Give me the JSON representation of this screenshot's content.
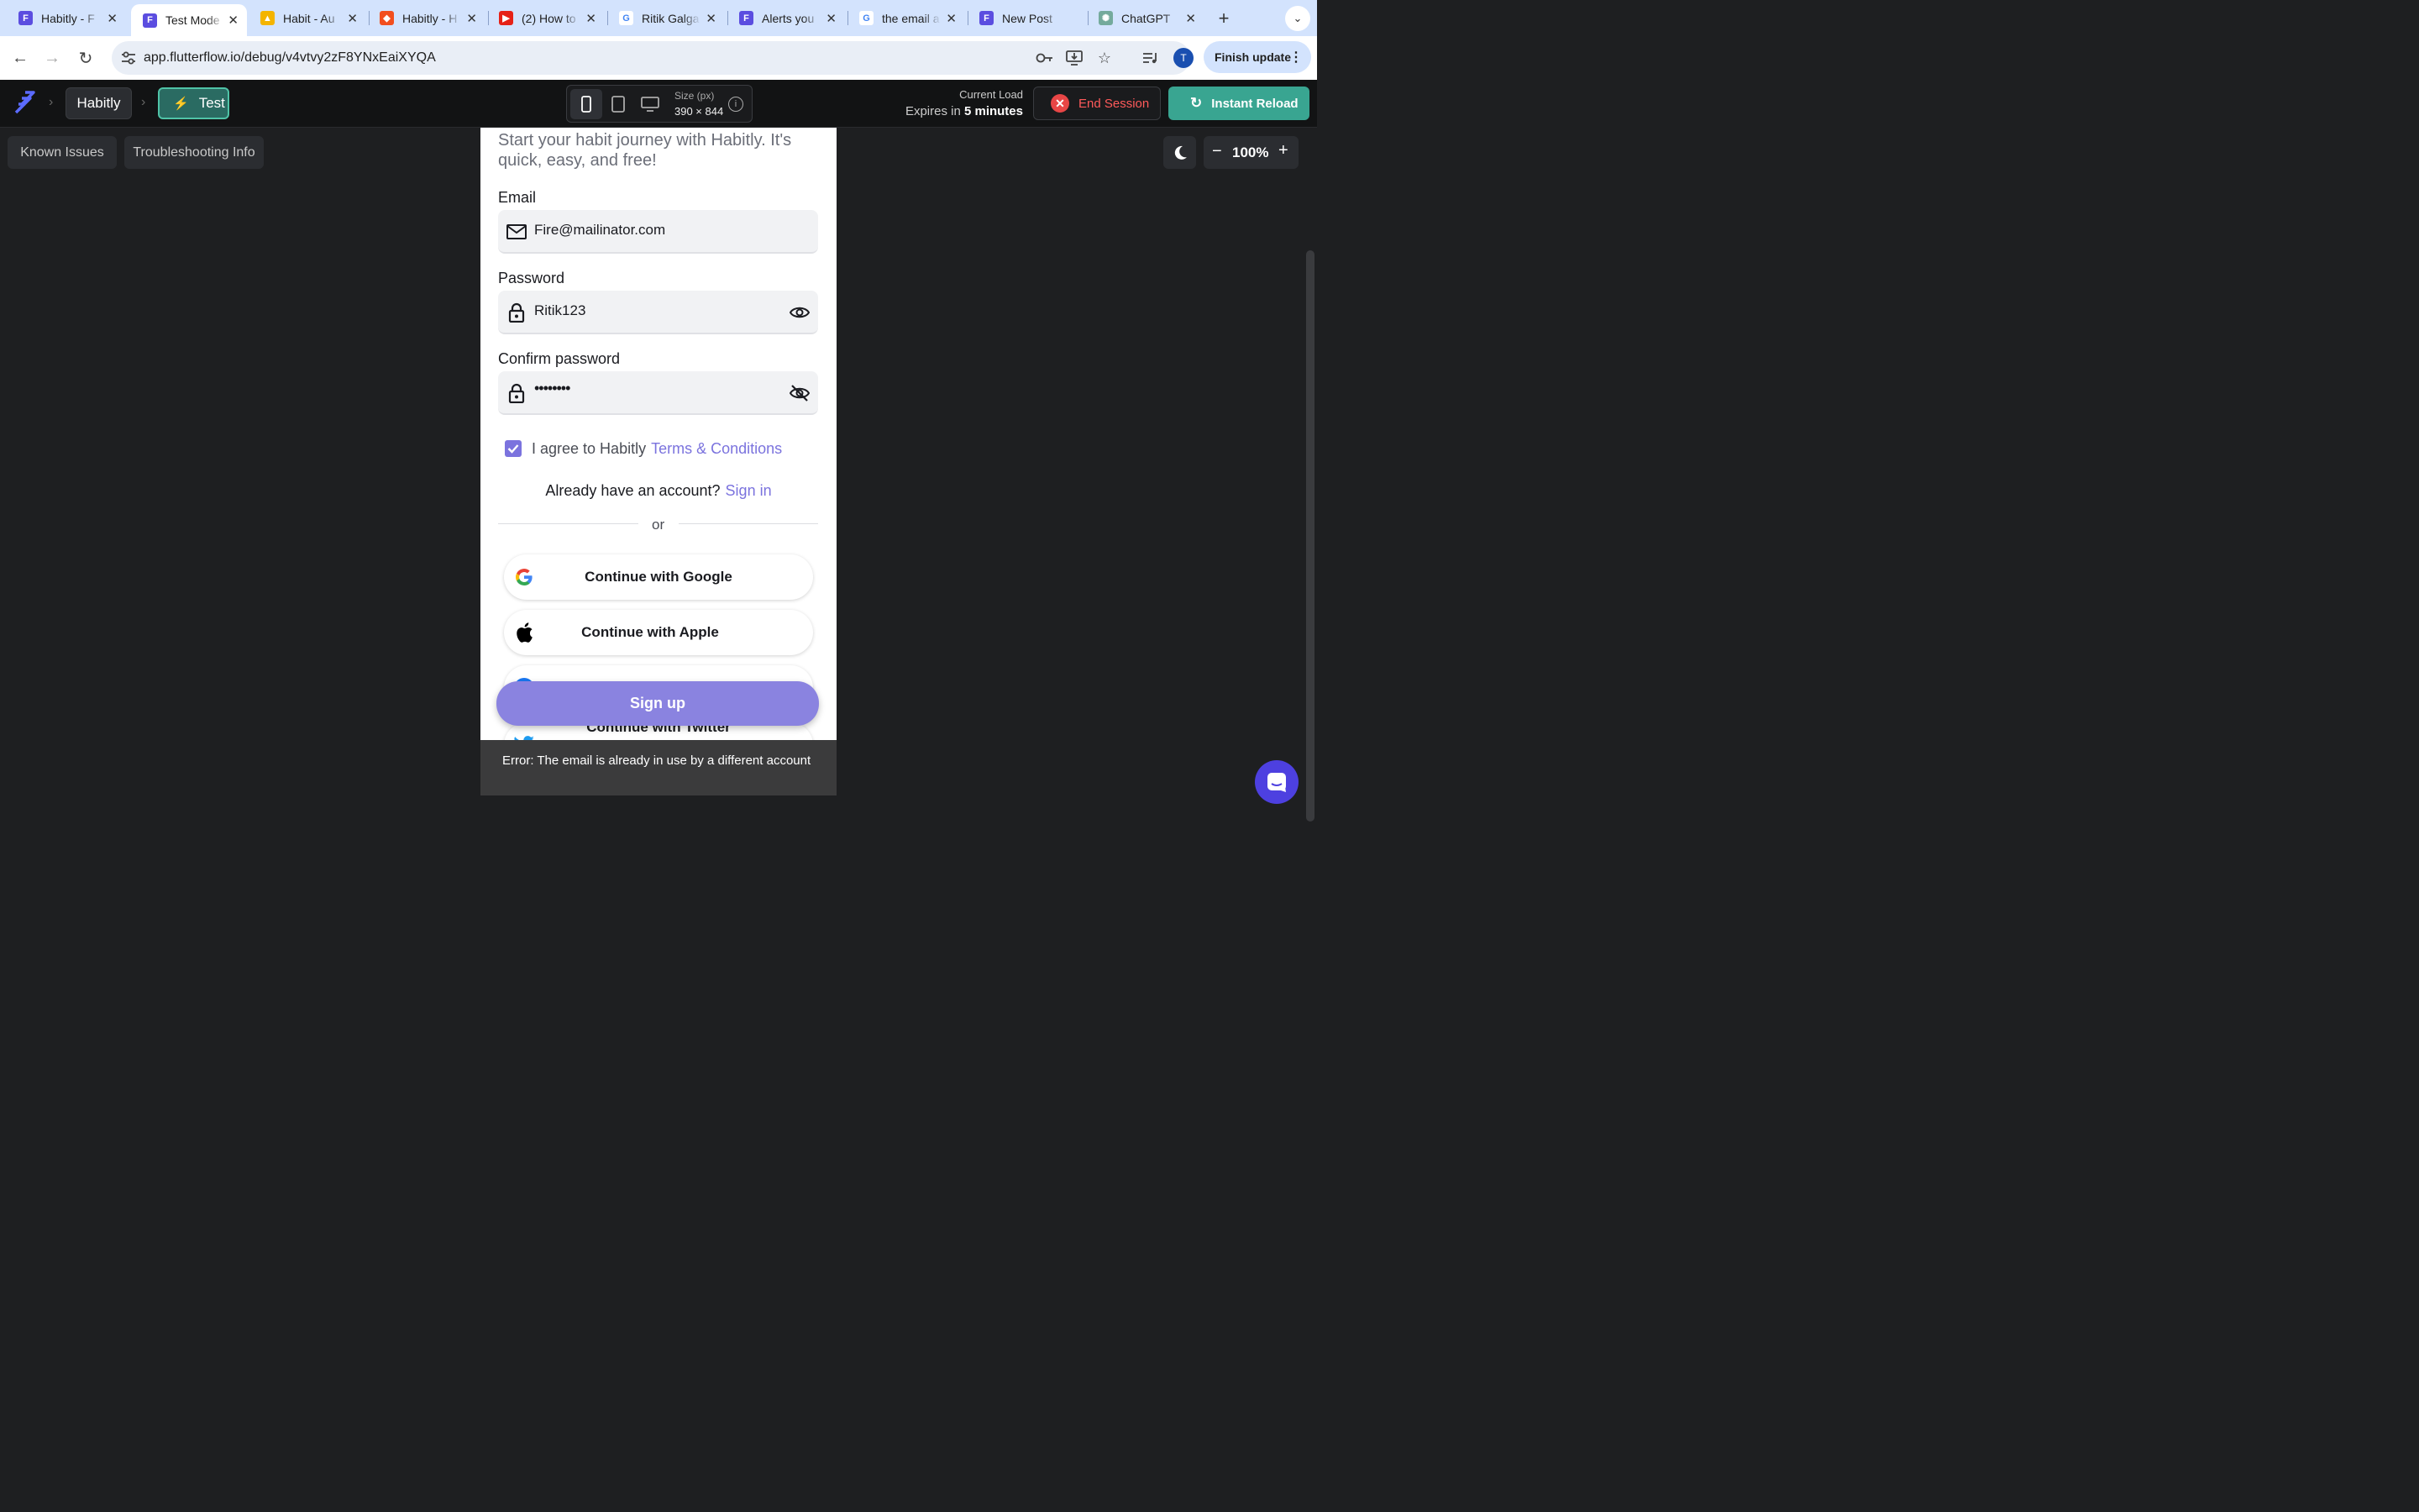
{
  "browser": {
    "tabs": [
      {
        "title": "Habitly - F",
        "icon": "flutterflow-icon",
        "color": "#5b4de0"
      },
      {
        "title": "Test Mode",
        "icon": "flutterflow-icon",
        "color": "#5b4de0",
        "active": true
      },
      {
        "title": "Habit - Au",
        "icon": "firebase-icon",
        "color": "#f4b400"
      },
      {
        "title": "Habitly - H",
        "icon": "figma-icon",
        "color": "#f24e1e"
      },
      {
        "title": "(2) How to",
        "icon": "youtube-icon",
        "color": "#e62117"
      },
      {
        "title": "Ritik Galga",
        "icon": "google-icon",
        "color": "#4285f4"
      },
      {
        "title": "Alerts you",
        "icon": "flutterflow-icon",
        "color": "#5b4de0"
      },
      {
        "title": "the email a",
        "icon": "google-icon",
        "color": "#4285f4"
      },
      {
        "title": "New Post",
        "icon": "flutterflow-icon",
        "color": "#5b4de0"
      },
      {
        "title": "ChatGPT",
        "icon": "chatgpt-icon",
        "color": "#74aa9c"
      }
    ],
    "url": "app.flutterflow.io/debug/v4vtvy2zF8YNxEaiXYQA",
    "avatar_letter": "T",
    "finish_update": "Finish update"
  },
  "debug_header": {
    "project": "Habitly",
    "mode": "Test",
    "size_label": "Size (px)",
    "size_value": "390 × 844",
    "current_load": "Current Load",
    "expires_prefix": "Expires in",
    "expires_value": "5 minutes",
    "end_session": "End Session",
    "instant_reload": "Instant Reload"
  },
  "canvas": {
    "known_issues": "Known Issues",
    "troubleshooting": "Troubleshooting Info",
    "zoom": "100%"
  },
  "phone": {
    "intro": "Start your habit journey with Habitly. It's quick, easy, and free!",
    "email_label": "Email",
    "email_value": "Fire@mailinator.com",
    "password_label": "Password",
    "password_value": "Ritik123",
    "confirm_label": "Confirm password",
    "confirm_value": "••••••••",
    "agree_text": "I agree to Habitly",
    "terms_link": "Terms & Conditions",
    "agree_checked": true,
    "already_text": "Already have an account?",
    "signin_link": "Sign in",
    "or_text": "or",
    "google_btn": "Continue with Google",
    "apple_btn": "Continue with Apple",
    "twitter_btn": "Continue with Twitter",
    "signup_btn": "Sign up",
    "accent_color": "#7b73de"
  },
  "toast": {
    "message": "Error: The email is already in use by a different account"
  }
}
